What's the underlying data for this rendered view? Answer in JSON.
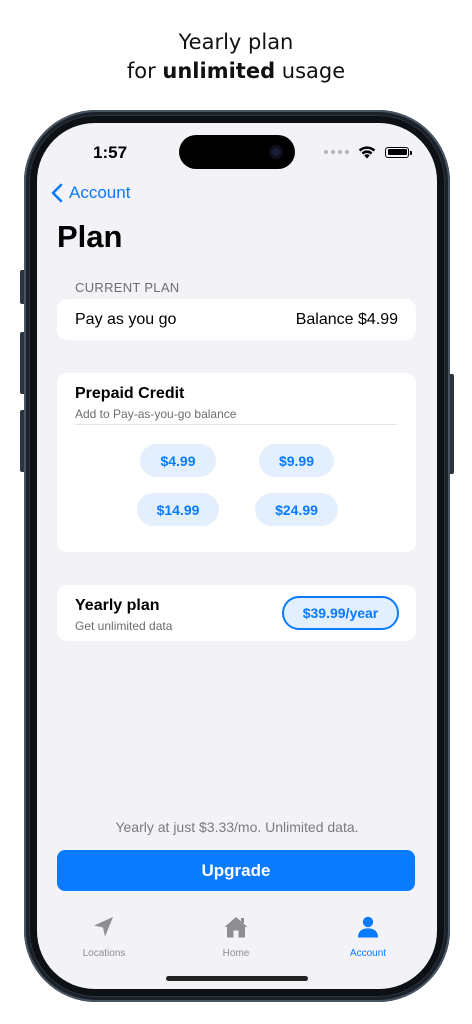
{
  "headline": {
    "line1": "Yearly plan",
    "line2_prefix": "for ",
    "line2_bold": "unlimited",
    "line2_suffix": " usage"
  },
  "status_bar": {
    "time": "1:57"
  },
  "nav": {
    "back_label": "Account"
  },
  "page": {
    "title": "Plan"
  },
  "current_plan": {
    "section_label": "CURRENT PLAN",
    "plan_name": "Pay as you go",
    "balance": "Balance $4.99"
  },
  "prepaid": {
    "title": "Prepaid Credit",
    "subtitle": "Add to Pay-as-you-go balance",
    "options": [
      "$4.99",
      "$9.99",
      "$14.99",
      "$24.99"
    ]
  },
  "yearly": {
    "title": "Yearly plan",
    "subtitle": "Get unlimited data",
    "price_label": "$39.99/year"
  },
  "footer": {
    "promo": "Yearly at just $3.33/mo. Unlimited data.",
    "upgrade_label": "Upgrade"
  },
  "tabbar": {
    "items": [
      {
        "label": "Locations",
        "icon": "location-arrow-icon",
        "active": false
      },
      {
        "label": "Home",
        "icon": "home-icon",
        "active": false
      },
      {
        "label": "Account",
        "icon": "person-icon",
        "active": true
      }
    ]
  },
  "colors": {
    "accent": "#0a7aff",
    "background": "#f2f2f7",
    "pill_bg": "#e3effd"
  }
}
